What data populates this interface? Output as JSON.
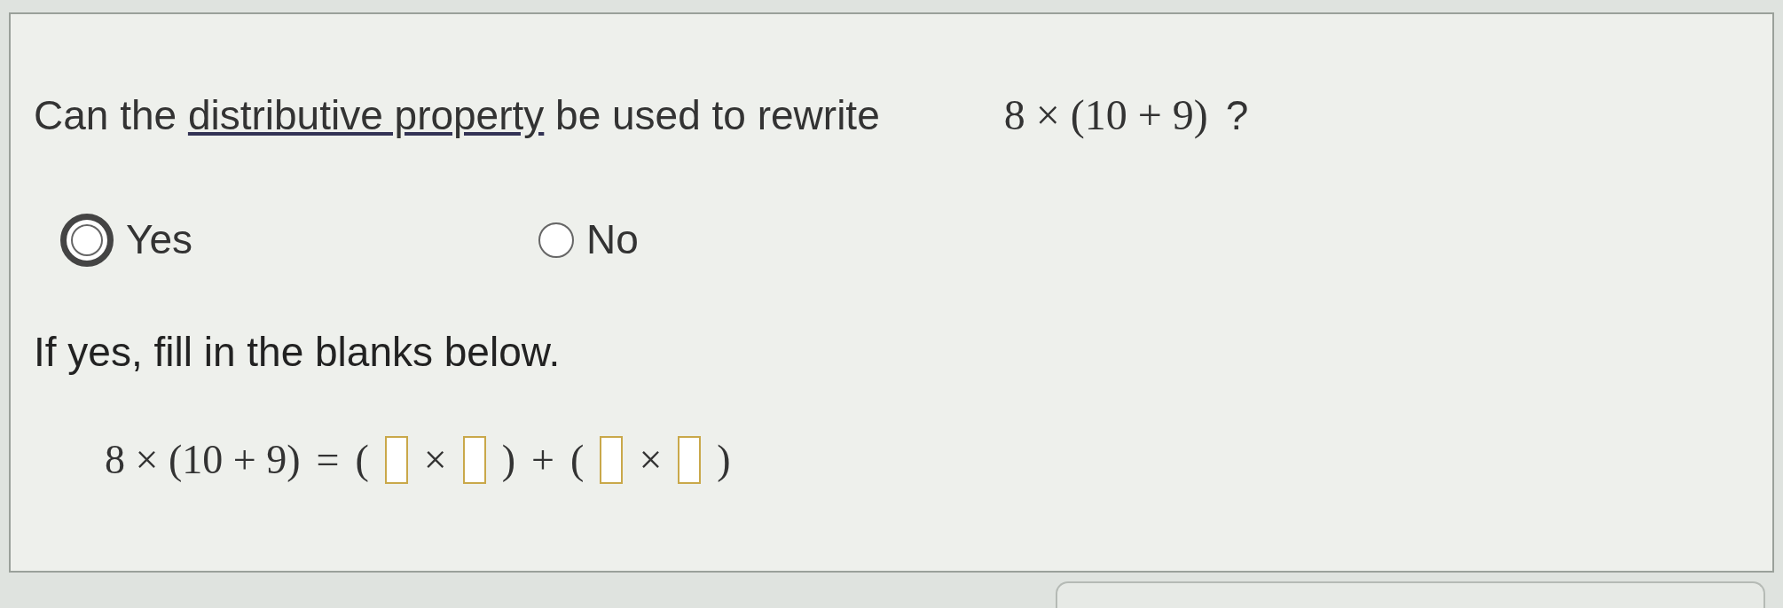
{
  "question": {
    "before": "Can the",
    "link": "distributive property",
    "after": "be used to rewrite",
    "expression": "8 × (10 + 9)",
    "end": "?"
  },
  "options": [
    {
      "label": "Yes",
      "selected": true
    },
    {
      "label": "No",
      "selected": false
    }
  ],
  "instruction": "If yes, fill in the blanks below.",
  "equation": [
    {
      "kind": "text",
      "text": "8 × (10 + 9)"
    },
    {
      "kind": "text",
      "text": "="
    },
    {
      "kind": "text",
      "text": "("
    },
    {
      "kind": "blank"
    },
    {
      "kind": "text",
      "text": "×"
    },
    {
      "kind": "blank"
    },
    {
      "kind": "text",
      "text": ")"
    },
    {
      "kind": "text",
      "text": "+"
    },
    {
      "kind": "text",
      "text": "("
    },
    {
      "kind": "blank"
    },
    {
      "kind": "text",
      "text": "×"
    },
    {
      "kind": "blank"
    },
    {
      "kind": "text",
      "text": ")"
    }
  ]
}
